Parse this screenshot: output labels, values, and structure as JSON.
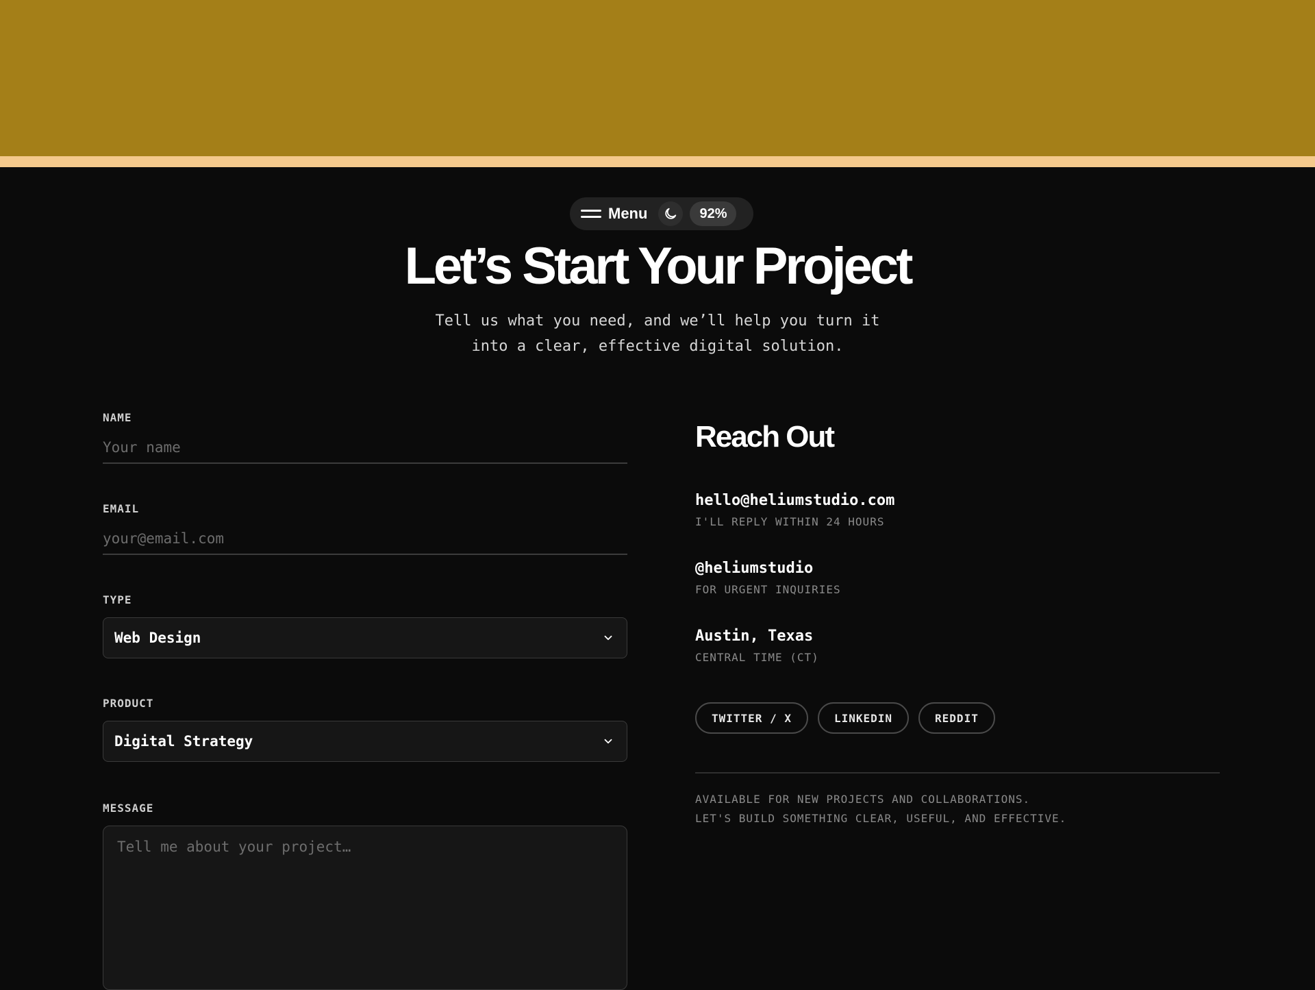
{
  "nav": {
    "menu_label": "Menu",
    "theme_icon": "moon-icon",
    "zoom": "92%"
  },
  "hero": {
    "title": "Let’s Start Your Project",
    "subtitle_line1": "Tell us what you need, and we’ll help you turn it",
    "subtitle_line2": "into a clear, effective digital solution."
  },
  "form": {
    "name": {
      "label": "NAME",
      "placeholder": "Your name"
    },
    "email": {
      "label": "EMAIL",
      "placeholder": "your@email.com"
    },
    "type": {
      "label": "TYPE",
      "value": "Web Design"
    },
    "product": {
      "label": "PRODUCT",
      "value": "Digital Strategy"
    },
    "message": {
      "label": "MESSAGE",
      "placeholder": "Tell me about your project…"
    }
  },
  "contact": {
    "title": "Reach Out",
    "items": [
      {
        "primary": "hello@heliumstudio.com",
        "secondary": "I'LL REPLY WITHIN 24 HOURS"
      },
      {
        "primary": "@heliumstudio",
        "secondary": "FOR URGENT INQUIRIES"
      },
      {
        "primary": "Austin, Texas",
        "secondary": "CENTRAL TIME (CT)"
      }
    ],
    "socials": [
      "TWITTER / X",
      "LINKEDIN",
      "REDDIT"
    ],
    "availability_line1": "AVAILABLE FOR NEW PROJECTS AND COLLABORATIONS.",
    "availability_line2": "LET'S BUILD SOMETHING CLEAR, USEFUL, AND EFFECTIVE."
  },
  "colors": {
    "top_band": "#a47f18",
    "top_stripe": "#f4c98c",
    "background": "#0b0b0b"
  }
}
